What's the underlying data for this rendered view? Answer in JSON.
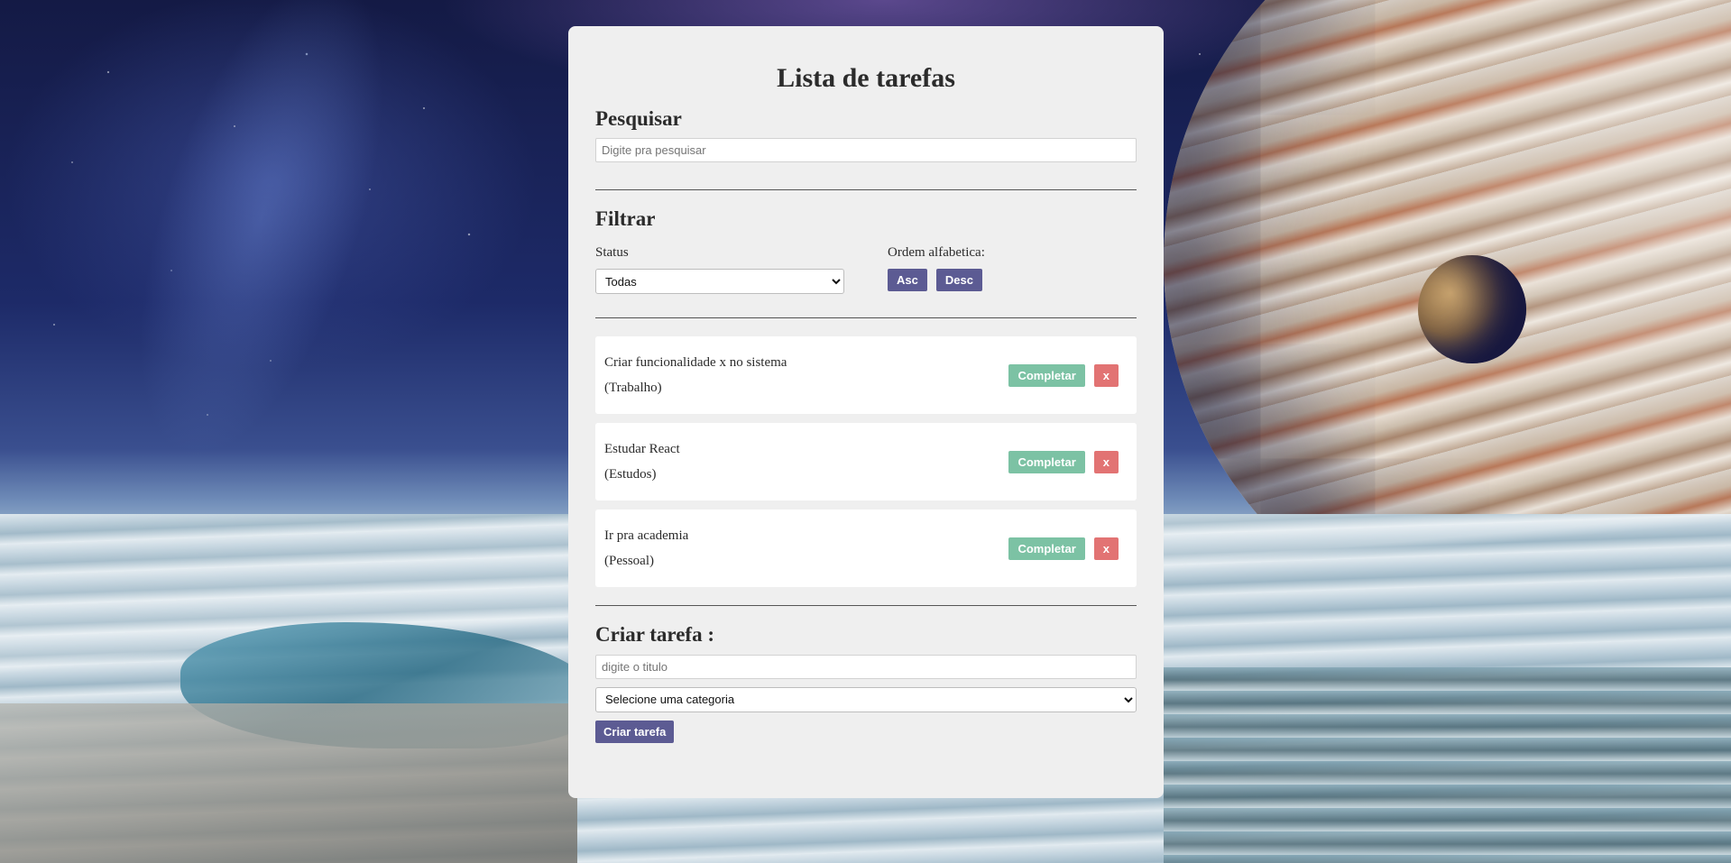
{
  "app": {
    "title": "Lista de tarefas"
  },
  "search": {
    "heading": "Pesquisar",
    "placeholder": "Digite pra pesquisar",
    "value": ""
  },
  "filter": {
    "heading": "Filtrar",
    "status_label": "Status",
    "status_selected": "Todas",
    "order_label": "Ordem alfabetica:",
    "asc_label": "Asc",
    "desc_label": "Desc"
  },
  "todos": [
    {
      "title": "Criar funcionalidade x no sistema",
      "category": "(Trabalho)",
      "complete_label": "Completar",
      "remove_label": "x"
    },
    {
      "title": "Estudar React",
      "category": "(Estudos)",
      "complete_label": "Completar",
      "remove_label": "x"
    },
    {
      "title": "Ir pra academia",
      "category": "(Pessoal)",
      "complete_label": "Completar",
      "remove_label": "x"
    }
  ],
  "create": {
    "heading": "Criar tarefa :",
    "title_placeholder": "digite o titulo",
    "category_selected": "Selecione uma categoria",
    "submit_label": "Criar tarefa"
  },
  "colors": {
    "card_bg": "#efefef",
    "primary": "#5c5b93",
    "complete": "#7cc2a4",
    "remove": "#e27373"
  }
}
